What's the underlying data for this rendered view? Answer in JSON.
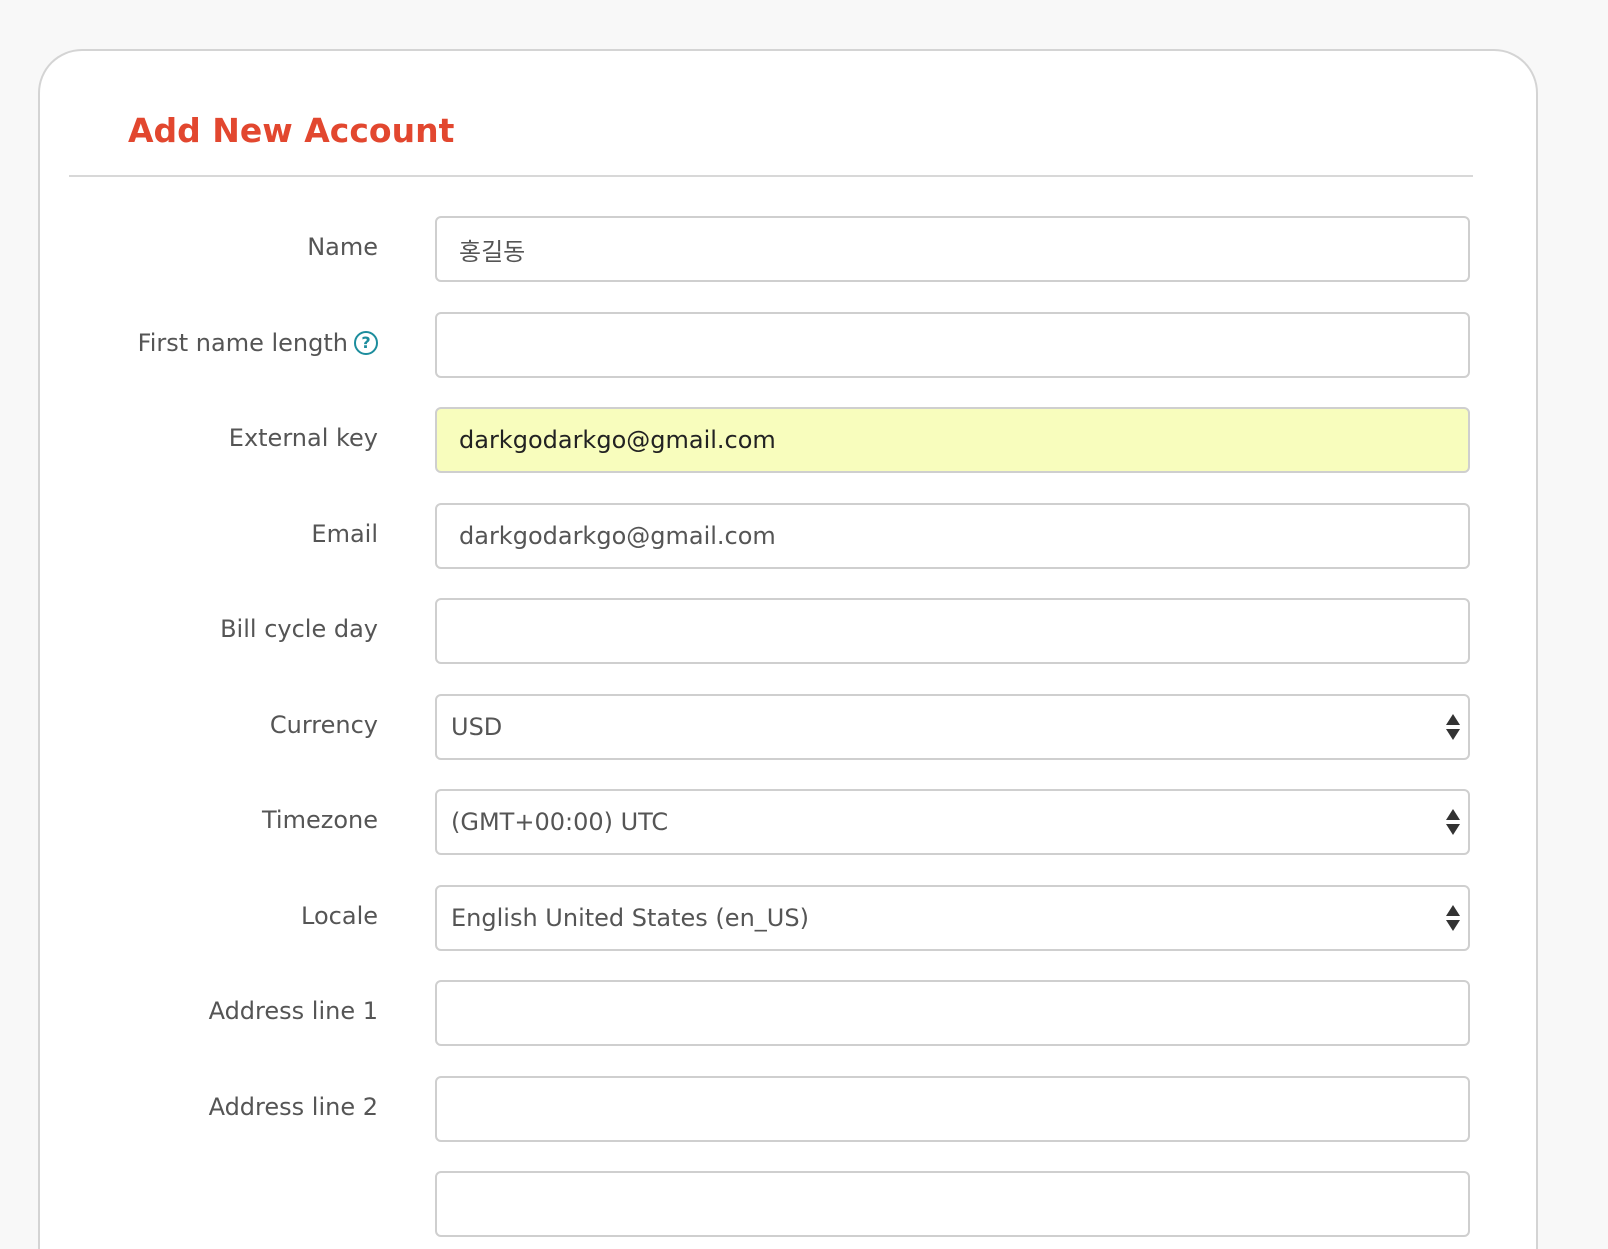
{
  "form": {
    "title": "Add New Account",
    "fields": {
      "name": {
        "label": "Name",
        "value": "홍길동"
      },
      "first_name_length": {
        "label": "First name length",
        "value": "",
        "help_icon": "question-circle-icon"
      },
      "external_key": {
        "label": "External key",
        "value": "darkgodarkgo@gmail.com",
        "highlight_color": "#f8fdbd"
      },
      "email": {
        "label": "Email",
        "value": "darkgodarkgo@gmail.com"
      },
      "bill_cycle_day": {
        "label": "Bill cycle day",
        "value": ""
      },
      "currency": {
        "label": "Currency",
        "selected": "USD"
      },
      "timezone": {
        "label": "Timezone",
        "selected": "(GMT+00:00) UTC"
      },
      "locale": {
        "label": "Locale",
        "selected": "English United States (en_US)"
      },
      "address_line_1": {
        "label": "Address line 1",
        "value": ""
      },
      "address_line_2": {
        "label": "Address line 2",
        "value": ""
      }
    }
  },
  "colors": {
    "accent": "#e2472f",
    "help_icon": "#1c8d9d",
    "border": "#cfcfcf",
    "background": "#f8f8f8"
  }
}
